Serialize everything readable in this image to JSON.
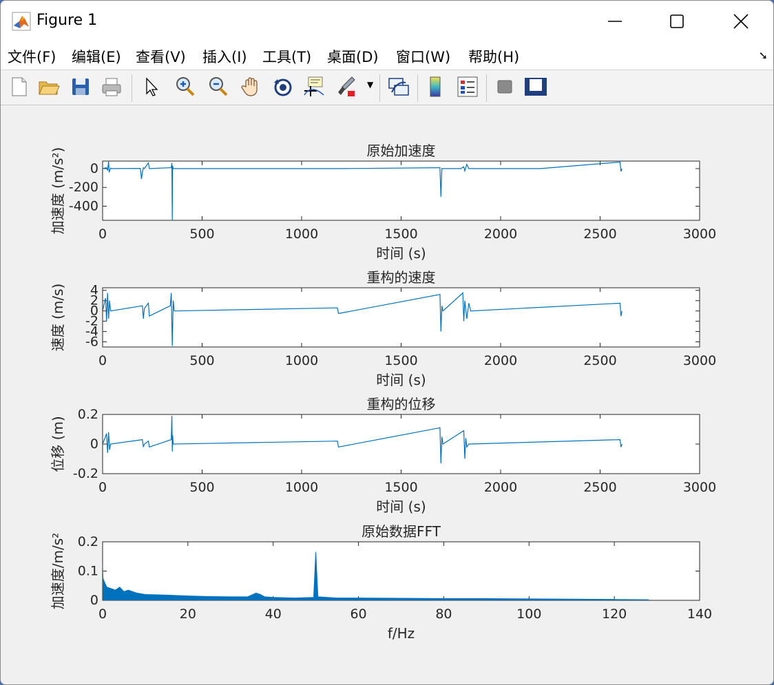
{
  "window": {
    "title": "Figure 1"
  },
  "menu": [
    {
      "label": "文件(F)"
    },
    {
      "label": "编辑(E)"
    },
    {
      "label": "查看(V)"
    },
    {
      "label": "插入(I)"
    },
    {
      "label": "工具(T)"
    },
    {
      "label": "桌面(D)"
    },
    {
      "label": "窗口(W)"
    },
    {
      "label": "帮助(H)"
    }
  ],
  "toolbar": [
    {
      "icon": "new-figure-icon"
    },
    {
      "icon": "open-file-icon"
    },
    {
      "icon": "save-icon"
    },
    {
      "icon": "print-icon"
    },
    {
      "icon": "pointer-icon"
    },
    {
      "icon": "zoom-in-icon"
    },
    {
      "icon": "zoom-out-icon"
    },
    {
      "icon": "pan-hand-icon"
    },
    {
      "icon": "rotate-3d-icon"
    },
    {
      "icon": "data-cursor-icon"
    },
    {
      "icon": "brush-icon"
    },
    {
      "icon": "link-plot-icon"
    },
    {
      "icon": "colorbar-icon"
    },
    {
      "icon": "legend-icon"
    },
    {
      "icon": "hide-plot-tools-icon"
    },
    {
      "icon": "show-plot-tools-icon"
    }
  ],
  "colors": {
    "line": "#0072bd",
    "axes_bg": "#ffffff",
    "figure_bg": "#f0f0f0"
  },
  "chart_data": [
    {
      "type": "line",
      "title": "原始加速度",
      "xlabel": "时间 (s)",
      "ylabel": "加速度 (m/s²)",
      "xlim": [
        0,
        3000
      ],
      "ylim": [
        -550,
        80
      ],
      "xticks": [
        "0",
        "500",
        "1000",
        "1500",
        "2000",
        "2500",
        "3000"
      ],
      "yticks": [
        "0",
        "-200",
        "-400"
      ],
      "series": [
        {
          "x": [
            0,
            20,
            25,
            30,
            33,
            40,
            45,
            190,
            195,
            200,
            205,
            210,
            230,
            235,
            345,
            348,
            350,
            352,
            355,
            600,
            1200,
            1695,
            1700,
            1705,
            1800,
            1815,
            1820,
            1830,
            1840,
            2200,
            2600,
            2605,
            2610
          ],
          "y": [
            0,
            10,
            -20,
            75,
            -40,
            5,
            0,
            2,
            -110,
            -40,
            10,
            0,
            60,
            0,
            10,
            60,
            -545,
            30,
            0,
            0,
            0,
            10,
            -300,
            0,
            0,
            20,
            -25,
            45,
            0,
            0,
            70,
            -30,
            0
          ]
        }
      ]
    },
    {
      "type": "line",
      "title": "重构的速度",
      "xlabel": "时间 (s)",
      "ylabel": "速度 (m/s)",
      "xlim": [
        0,
        3000
      ],
      "ylim": [
        -7,
        4.5
      ],
      "xticks": [
        "0",
        "500",
        "1000",
        "1500",
        "2000",
        "2500",
        "3000"
      ],
      "yticks": [
        "4",
        "2",
        "0",
        "-2",
        "-4",
        "-6"
      ],
      "series": [
        {
          "x": [
            0,
            15,
            20,
            25,
            30,
            35,
            40,
            200,
            205,
            210,
            230,
            235,
            340,
            345,
            350,
            355,
            360,
            1180,
            1185,
            1695,
            1700,
            1705,
            1710,
            1810,
            1815,
            1820,
            1830,
            1840,
            1850,
            2600,
            2605,
            2610
          ],
          "y": [
            0,
            2.5,
            -2,
            3.5,
            -1.5,
            2,
            0,
            1,
            -1.5,
            0.5,
            1.5,
            -1,
            1,
            3.5,
            -6.8,
            2,
            0,
            0.6,
            -0.5,
            3.2,
            -4,
            1,
            0,
            3.5,
            -2,
            2,
            -1.5,
            1.5,
            0,
            1.5,
            -1,
            0
          ]
        }
      ]
    },
    {
      "type": "line",
      "title": "重构的位移",
      "xlabel": "时间 (s)",
      "ylabel": "位移 (m)",
      "xlim": [
        0,
        3000
      ],
      "ylim": [
        -0.2,
        0.2
      ],
      "xticks": [
        "0",
        "500",
        "1000",
        "1500",
        "2000",
        "2500",
        "3000"
      ],
      "yticks": [
        "0.2",
        "0",
        "-0.2"
      ],
      "series": [
        {
          "x": [
            0,
            20,
            25,
            30,
            35,
            40,
            200,
            205,
            210,
            230,
            235,
            345,
            348,
            350,
            352,
            355,
            1180,
            1185,
            1695,
            1700,
            1705,
            1710,
            1815,
            1820,
            1825,
            1830,
            1840,
            2600,
            2605,
            2610
          ],
          "y": [
            0,
            0.07,
            -0.06,
            0.08,
            -0.04,
            0,
            0.03,
            -0.02,
            0,
            0.02,
            -0.02,
            0.03,
            0.19,
            -0.05,
            0.06,
            0,
            0.02,
            -0.02,
            0.11,
            -0.13,
            0.05,
            0,
            0.09,
            -0.1,
            0.04,
            -0.02,
            0,
            0.03,
            -0.02,
            0
          ]
        }
      ]
    },
    {
      "type": "area",
      "title": "原始数据FFT",
      "xlabel": "f/Hz",
      "ylabel": "加速度/m/s²",
      "xlim": [
        0,
        140
      ],
      "ylim": [
        0,
        0.2
      ],
      "xticks": [
        "0",
        "20",
        "40",
        "60",
        "80",
        "100",
        "120",
        "140"
      ],
      "yticks": [
        "0.2",
        "0.1",
        "0"
      ],
      "series": [
        {
          "x": [
            0,
            0.1,
            0.5,
            1,
            2,
            3,
            4,
            5,
            6,
            8,
            10,
            15,
            20,
            25,
            30,
            34,
            36,
            37,
            38,
            40,
            45,
            49.5,
            50,
            50.5,
            55,
            60,
            70,
            80,
            90,
            100,
            110,
            120,
            128
          ],
          "y": [
            0.12,
            0.075,
            0.06,
            0.045,
            0.04,
            0.035,
            0.045,
            0.03,
            0.035,
            0.025,
            0.02,
            0.018,
            0.015,
            0.013,
            0.012,
            0.012,
            0.025,
            0.02,
            0.012,
            0.01,
            0.008,
            0.01,
            0.165,
            0.012,
            0.008,
            0.008,
            0.007,
            0.006,
            0.006,
            0.005,
            0.004,
            0.003,
            0.002
          ]
        }
      ]
    }
  ]
}
